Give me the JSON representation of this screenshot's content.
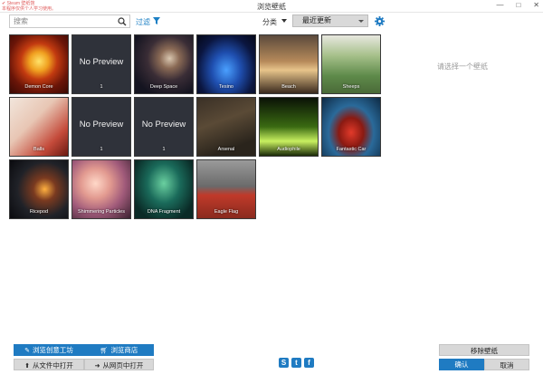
{
  "window": {
    "title": "浏览壁纸",
    "controls": [
      "—",
      "□",
      "✕"
    ],
    "watermark": [
      "✔ Steam 壁纸馆",
      "本程序仅供个人学习使用。"
    ]
  },
  "toolbar": {
    "search_placeholder": "搜索",
    "filter_label": "过滤",
    "sort_label": "分类",
    "sort_value": "最近更新"
  },
  "wallpapers": [
    {
      "name": "Demon Core",
      "kind": "demon"
    },
    {
      "name": "1",
      "kind": "nopreview",
      "preview_text": "No Preview"
    },
    {
      "name": "Deep Space",
      "kind": "space"
    },
    {
      "name": "Tesino",
      "kind": "hex"
    },
    {
      "name": "Beach",
      "kind": "beach"
    },
    {
      "name": "Sheeps",
      "kind": "sheeps"
    },
    {
      "name": "Balls",
      "kind": "balls"
    },
    {
      "name": "1",
      "kind": "nopreview",
      "preview_text": "No Preview"
    },
    {
      "name": "1",
      "kind": "nopreview",
      "preview_text": "No Preview"
    },
    {
      "name": "Arsenal",
      "kind": "arsenal"
    },
    {
      "name": "Audiophile",
      "kind": "audio"
    },
    {
      "name": "Fantastic Car",
      "kind": "car"
    },
    {
      "name": "Ricepod",
      "kind": "ricepod"
    },
    {
      "name": "Shimmering Particles",
      "kind": "particles"
    },
    {
      "name": "DNA Fragment",
      "kind": "dna"
    },
    {
      "name": "Eagle Flag",
      "kind": "eagle"
    }
  ],
  "preview_panel": {
    "placeholder": "请选择一个壁纸"
  },
  "buttons": {
    "workshop": "浏览创意工坊",
    "store": "浏览商店",
    "open_file": "从文件中打开",
    "open_web": "从网页中打开",
    "remove": "移除壁纸",
    "ok": "确认",
    "cancel": "取消"
  },
  "social": [
    {
      "name": "steam-icon",
      "glyph": "S"
    },
    {
      "name": "twitter-icon",
      "glyph": "t"
    },
    {
      "name": "facebook-icon",
      "glyph": "f"
    }
  ],
  "colors": {
    "accent": "#1f7bc2",
    "filter_link": "#1b7fc4"
  }
}
